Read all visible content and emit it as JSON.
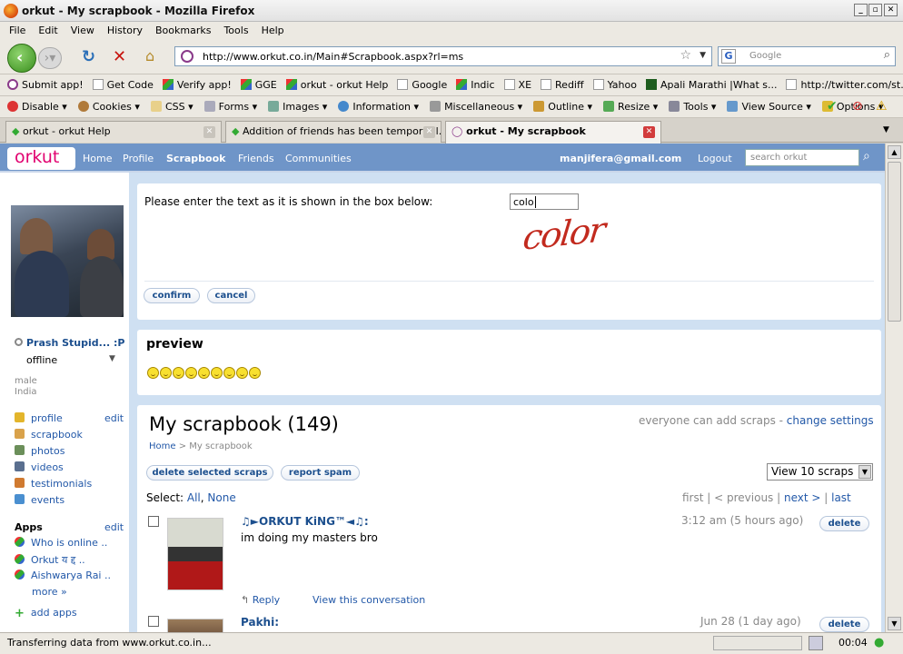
{
  "window": {
    "title": "orkut - My scrapbook - Mozilla Firefox"
  },
  "menu": [
    "File",
    "Edit",
    "View",
    "History",
    "Bookmarks",
    "Tools",
    "Help"
  ],
  "url": "http://www.orkut.co.in/Main#Scrapbook.aspx?rl=ms",
  "search_placeholder": "Google",
  "bookmarks": [
    "Submit app!",
    "Get Code",
    "Verify app!",
    "GGE",
    "orkut - orkut Help",
    "Google",
    "Indic",
    "XE",
    "Rediff",
    "Yahoo",
    "Apali Marathi |What s...",
    "http://twitter.com/st..."
  ],
  "webdev": [
    "Disable",
    "Cookies",
    "CSS",
    "Forms",
    "Images",
    "Information",
    "Miscellaneous",
    "Outline",
    "Resize",
    "Tools",
    "View Source",
    "Options"
  ],
  "tabs": [
    {
      "label": "orkut - orkut Help"
    },
    {
      "label": "Addition of friends has been temporaril..."
    },
    {
      "label": "orkut - My scrapbook"
    }
  ],
  "orkut_nav": {
    "logo": "orkut",
    "items": [
      "Home",
      "Profile",
      "Scrapbook",
      "Friends",
      "Communities"
    ],
    "email": "manjifera@gmail.com",
    "logout": "Logout",
    "search_placeholder": "search orkut"
  },
  "profile": {
    "name": "Prash Stupid... :P",
    "status": "offline",
    "gender": "male",
    "country": "India",
    "links": [
      "profile",
      "scrapbook",
      "photos",
      "videos",
      "testimonials",
      "events"
    ],
    "edit": "edit",
    "apps_title": "Apps",
    "apps": [
      "Who is online ..",
      "Orkut य द्द ..",
      "Aishwarya Rai ..",
      "more »"
    ],
    "add_apps": "add apps"
  },
  "captcha": {
    "prompt": "Please enter the text as it is shown in the box below:",
    "input_value": "colo",
    "image_text": "color",
    "confirm": "confirm",
    "cancel": "cancel"
  },
  "preview": {
    "title": "preview",
    "smiley_count": 9
  },
  "scrapbook": {
    "title": "My scrapbook (149)",
    "settings_prefix": "everyone can add scraps - ",
    "settings_link": "change settings",
    "breadcrumb_home": "Home",
    "breadcrumb_sep": ">",
    "breadcrumb_current": "My scrapbook",
    "delete_selected": "delete selected scraps",
    "report_spam": "report spam",
    "view_select": "View 10 scraps",
    "select_label": "Select:",
    "select_all": "All",
    "select_none": "None",
    "pager": {
      "first": "first",
      "previous": "< previous",
      "next": "next >",
      "last": "last"
    },
    "scraps": [
      {
        "author": "♫►ORKUT KiNG™◄♫:",
        "text": "im doing my masters bro",
        "time": "3:12 am (5 hours ago)",
        "delete": "delete",
        "reply": "Reply",
        "view": "View this conversation"
      },
      {
        "author": "Pakhi:",
        "time": "Jun 28 (1 day ago)",
        "delete": "delete"
      }
    ]
  },
  "status": {
    "text": "Transferring data from www.orkut.co.in...",
    "clock": "00:04"
  }
}
